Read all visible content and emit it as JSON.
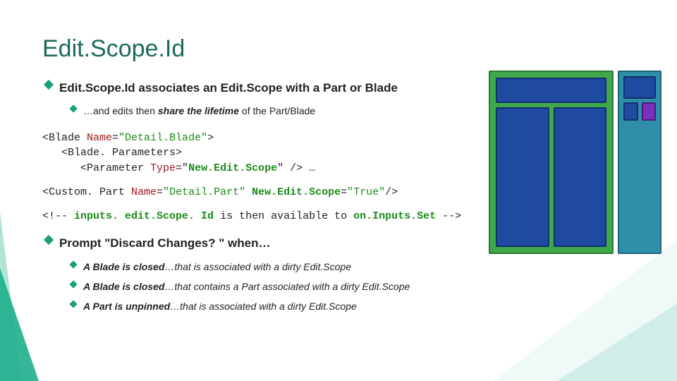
{
  "title": "Edit.Scope.Id",
  "b1": "Edit.Scope.Id associates an Edit.Scope with a Part or Blade",
  "b1a_pre": "…and edits then ",
  "b1a_em": "share the lifetime",
  "b1a_post": " of the Part/Blade",
  "code1": {
    "l1a": "<Blade ",
    "l1b": "Name",
    "l1c": "=",
    "l1d": "\"Detail.Blade\"",
    "l1e": ">",
    "l2a": "   <Blade. Parameters>",
    "l3a": "      <Parameter ",
    "l3b": "Type",
    "l3c": "=\"",
    "l3d": "New.Edit.Scope",
    "l3e": "\" /> …"
  },
  "code2": {
    "l1a": "<Custom. Part ",
    "l1b": "Name",
    "l1c": "=",
    "l1d": "\"Detail.Part\" ",
    "l1e": "New.Edit.Scope",
    "l1f": "=",
    "l1g": "\"True\"",
    "l1h": "/>"
  },
  "code3": {
    "l1a": "<!-- ",
    "l1b": "inputs. edit.Scope. Id",
    "l1c": " is then available to ",
    "l1d": "on.Inputs.Set",
    "l1e": " -->"
  },
  "b2": "Prompt \"Discard Changes? \" when…",
  "b2a_b": "A Blade is closed",
  "b2a_r": "…that is associated with a dirty Edit.Scope",
  "b2b_b": "A Blade is closed",
  "b2b_r": "…that contains a Part associated with a dirty Edit.Scope",
  "b2c_b": "A Part is unpinned",
  "b2c_r": "…that is associated with a dirty Edit.Scope"
}
